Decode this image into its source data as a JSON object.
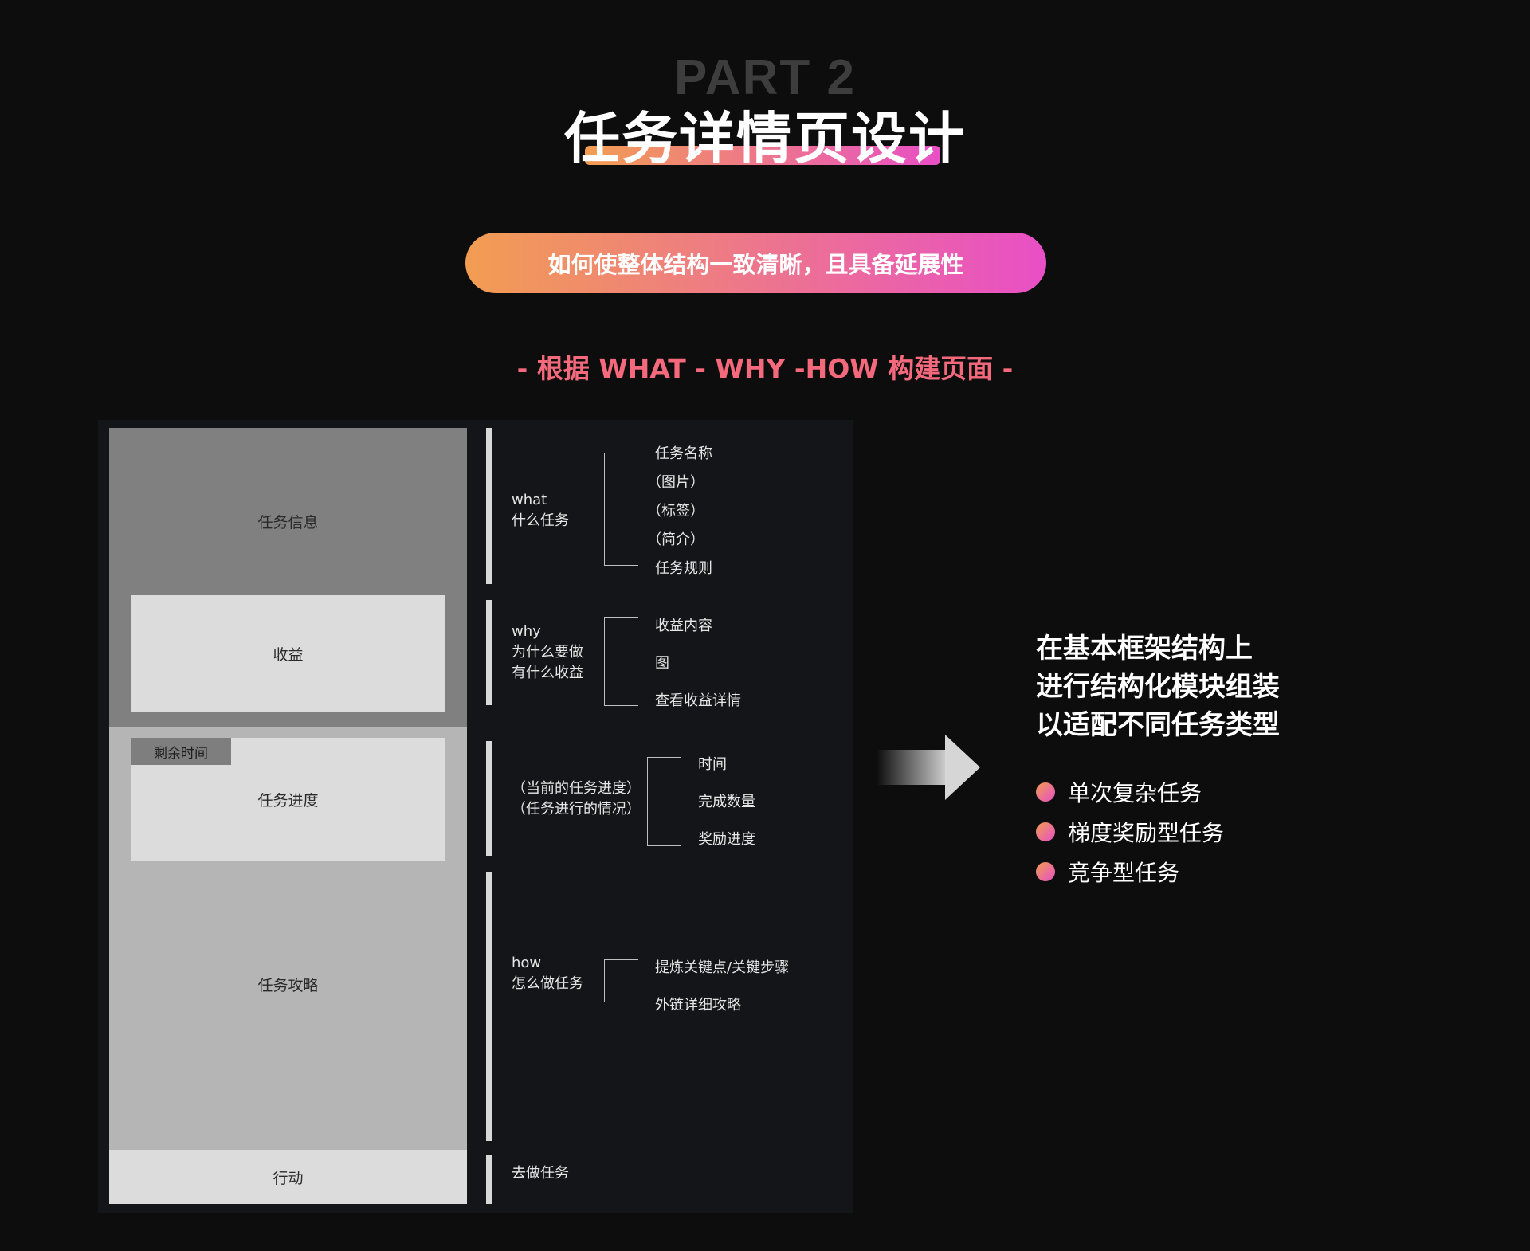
{
  "header": {
    "part_label": "PART 2",
    "title": "任务详情页设计",
    "pill_text": "如何使整体结构一致清晰，且具备延展性",
    "subtitle": "- 根据 WHAT - WHY -HOW 构建页面 -"
  },
  "wireframe": {
    "task_info": "任务信息",
    "income": "收益",
    "remaining_time": "剩余时间",
    "task_progress": "任务进度",
    "task_strategy": "任务攻略",
    "action": "行动"
  },
  "sections": {
    "what": {
      "line1": "what",
      "line2": "什么任务",
      "items": [
        "任务名称",
        "（图片）",
        "（标签）",
        "（简介）",
        "任务规则"
      ]
    },
    "why": {
      "line1": "why",
      "line2": "为什么要做",
      "line3": "有什么收益",
      "items": [
        "收益内容",
        "图",
        "查看收益详情"
      ]
    },
    "progress": {
      "line1": "（当前的任务进度）",
      "line2": "（任务进行的情况）",
      "items": [
        "时间",
        "完成数量",
        "奖励进度"
      ]
    },
    "how": {
      "line1": "how",
      "line2": "怎么做任务",
      "items": [
        "提炼关键点/关键步骤",
        "外链详细攻略"
      ]
    },
    "action": {
      "line1": "去做任务"
    }
  },
  "right_panel": {
    "title_lines": [
      "在基本框架结构上",
      "进行结构化模块组装",
      "以适配不同任务类型"
    ],
    "bullets": [
      "单次复杂任务",
      "梯度奖励型任务",
      "竞争型任务"
    ]
  },
  "colors": {
    "gradient_start": "#f29d52",
    "gradient_end": "#e84fc6",
    "subtitle": "#f4697c",
    "background": "#0d0d0d"
  }
}
